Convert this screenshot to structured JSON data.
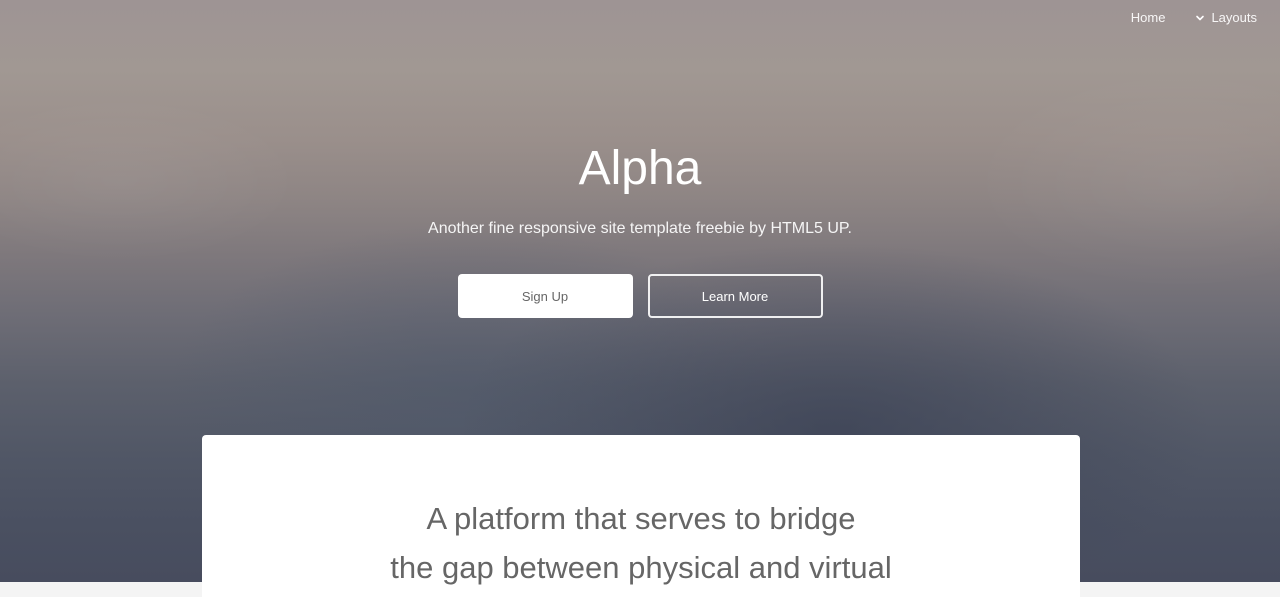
{
  "nav": {
    "items": [
      {
        "label": "Home"
      },
      {
        "label": "Layouts",
        "icon": "chevron-down-icon"
      }
    ]
  },
  "hero": {
    "title": "Alpha",
    "subtitle": "Another fine responsive site template freebie by HTML5 UP.",
    "buttons": {
      "primary": "Sign Up",
      "secondary": "Learn More"
    }
  },
  "feature": {
    "line1": "A platform that serves to bridge",
    "line2": "the gap between physical and virtual"
  },
  "colors": {
    "hero_top": "#9e9494",
    "hero_bottom": "#474c5e",
    "card_background": "#ffffff",
    "page_background": "#f4f4f4",
    "text_primary": "#666666",
    "text_inverse": "#ffffff"
  }
}
